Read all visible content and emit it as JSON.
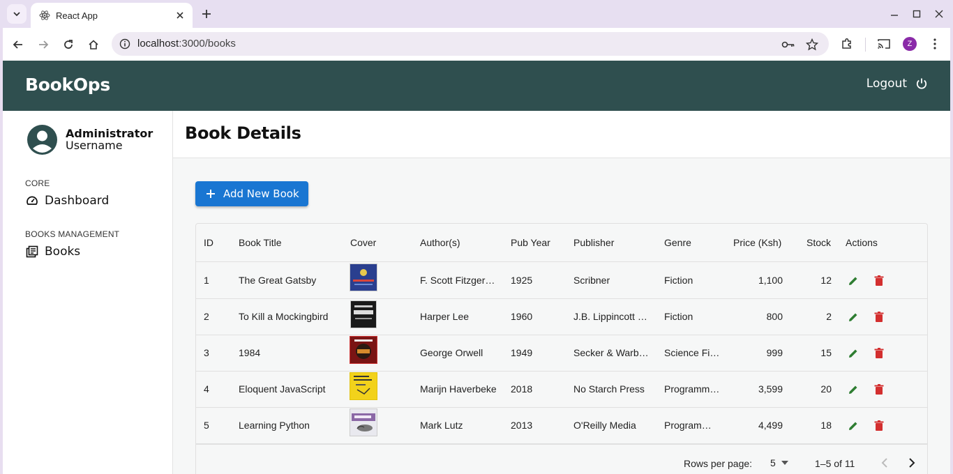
{
  "browser": {
    "tab_title": "React App",
    "url_host": "localhost",
    "url_rest": ":3000/books",
    "profile_initial": "Z"
  },
  "app": {
    "brand": "BookOps",
    "logout_label": "Logout"
  },
  "sidebar": {
    "user_role": "Administrator",
    "user_name": "Username",
    "sections": [
      {
        "label": "CORE",
        "item": "Dashboard"
      },
      {
        "label": "BOOKS MANAGEMENT",
        "item": "Books"
      }
    ]
  },
  "main": {
    "title": "Book Details",
    "add_button": "Add New Book"
  },
  "table": {
    "columns": [
      "ID",
      "Book Title",
      "Cover",
      "Author(s)",
      "Pub Year",
      "Publisher",
      "Genre",
      "Price (Ksh)",
      "Stock",
      "Actions"
    ],
    "rows": [
      {
        "id": "1",
        "title": "The Great Gatsby",
        "author": "F. Scott Fitzgerald",
        "year": "1925",
        "publisher": "Scribner",
        "genre": "Fiction",
        "price": "1,100",
        "stock": "12",
        "cover_color": "#2a3f8f"
      },
      {
        "id": "2",
        "title": "To Kill a Mockingbird",
        "author": "Harper Lee",
        "year": "1960",
        "publisher": "J.B. Lippincott & Co.",
        "genre": "Fiction",
        "price": "800",
        "stock": "2",
        "cover_color": "#1a1a1a"
      },
      {
        "id": "3",
        "title": "1984",
        "author": "George Orwell",
        "year": "1949",
        "publisher": "Secker & Warburg",
        "genre": "Science Fiction",
        "price": "999",
        "stock": "15",
        "cover_color": "#7a1414"
      },
      {
        "id": "4",
        "title": "Eloquent JavaScript",
        "author": "Marijn Haverbeke",
        "year": "2018",
        "publisher": "No Starch Press",
        "genre": "Programming",
        "price": "3,599",
        "stock": "20",
        "cover_color": "#f2d21b"
      },
      {
        "id": "5",
        "title": "Learning Python",
        "author": "Mark Lutz",
        "year": "2013",
        "publisher": "O'Reilly Media",
        "genre": "Programming",
        "price": "4,499",
        "stock": "18",
        "cover_color": "#e9e9ef"
      }
    ]
  },
  "pagination": {
    "rows_per_page_label": "Rows per page:",
    "rows_per_page": "5",
    "range": "1–5 of 11"
  },
  "colors": {
    "appbar": "#2f4f4f",
    "primary": "#1976d2",
    "edit": "#2e7d32",
    "delete": "#d32f2f"
  }
}
